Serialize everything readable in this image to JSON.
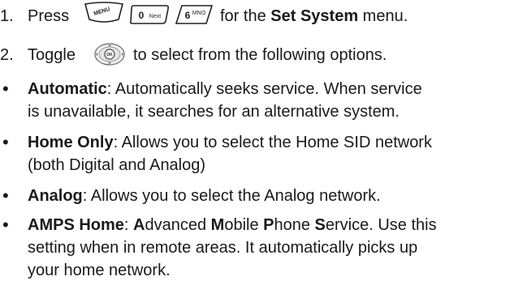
{
  "steps": [
    {
      "num": "1.",
      "pre": "Press",
      "keys": [
        {
          "icon": "menu-key-icon",
          "label": "MENU"
        },
        {
          "icon": "zero-key-icon",
          "main": "0",
          "sub": "Next"
        },
        {
          "icon": "six-key-icon",
          "main": "6",
          "sub": "MNO"
        }
      ],
      "mid": "for the",
      "bold": "Set System",
      "post": "menu."
    },
    {
      "num": "2.",
      "pre": "Toggle",
      "icon": "navigation-key-icon",
      "icon_label": "OK",
      "post": "to select from the following options."
    }
  ],
  "bullets": [
    {
      "glyph": "•",
      "term": "Automatic",
      "line1": ": Automatically seeks service. When service",
      "line2": "is unavailable, it searches for an alternative system."
    },
    {
      "glyph": "•",
      "term": "Home Only",
      "line1": ": Allows you to select the Home SID network",
      "line2": "(both Digital and Analog)"
    },
    {
      "glyph": "•",
      "term": "Analog",
      "line1": ": Allows you to select the Analog network."
    },
    {
      "glyph": "•",
      "term": "AMPS Home",
      "l1_sep": ": ",
      "l1_a": "A",
      "l1_a_rest": "dvanced ",
      "l1_m": "M",
      "l1_m_rest": "obile ",
      "l1_p": "P",
      "l1_p_rest": "hone ",
      "l1_s": "S",
      "l1_s_rest": "ervice. Use this",
      "line2": "setting when in remote areas. It automatically picks up",
      "line3": "your home network."
    }
  ]
}
